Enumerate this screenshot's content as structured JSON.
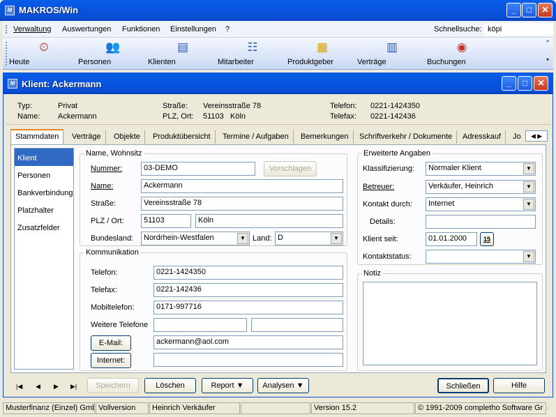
{
  "window": {
    "title": "MAKROS/Win",
    "icon": "app-icon",
    "icon_text": "M"
  },
  "menu": {
    "items": [
      "Verwaltung",
      "Auswertungen",
      "Funktionen",
      "Einstellungen",
      "?"
    ],
    "quicksearch_label": "Schnellsuche:",
    "quicksearch_value": "köpi"
  },
  "toolbar": {
    "items": [
      {
        "label": "Heute",
        "icon": "calendar-clock-icon"
      },
      {
        "label": "Personen",
        "icon": "people-icon"
      },
      {
        "label": "Klienten",
        "icon": "id-card-icon"
      },
      {
        "label": "Mitarbeiter",
        "icon": "org-chart-icon"
      },
      {
        "label": "Produktgeber",
        "icon": "products-icon"
      },
      {
        "label": "Verträge",
        "icon": "contract-chart-icon"
      },
      {
        "label": "Buchungen",
        "icon": "booking-icon"
      }
    ]
  },
  "child": {
    "title": "Klient: Ackermann",
    "info": {
      "typ_label": "Typ:",
      "typ_value": "Privat",
      "name_label": "Name:",
      "name_value": "Ackermann",
      "strasse_label": "Straße:",
      "strasse_value": "Vereinsstraße 78",
      "plz_label": "PLZ, Ort:",
      "plz_value": "51103   Köln",
      "telefon_label": "Telefon:",
      "telefon_value": "0221-1424350",
      "telefax_label": "Telefax:",
      "telefax_value": "0221-142436"
    },
    "tabs": [
      "Stammdaten",
      "Verträge",
      "Objekte",
      "Produktübersicht",
      "Termine / Aufgaben",
      "Bemerkungen",
      "Schriftverkehr / Dokumente",
      "Adresskauf",
      "Jo"
    ],
    "sidenav": [
      "Klient",
      "Personen",
      "Bankverbindung",
      "Platzhalter",
      "Zusatzfelder"
    ],
    "name_section": {
      "legend": "Name, Wohnsitz",
      "nummer_label": "Nummer:",
      "nummer_value": "03-DEMO",
      "vorschlagen": "Vorschlagen",
      "name_label": "Name:",
      "name_value": "Ackermann",
      "strasse_label": "Straße:",
      "strasse_value": "Vereinsstraße 78",
      "plz_label": "PLZ / Ort:",
      "plz_value": "51103",
      "ort_value": "Köln",
      "bundesland_label": "Bundesland:",
      "bundesland_value": "Nordrhein-Westfalen",
      "land_label": "Land:",
      "land_value": "D"
    },
    "comm_section": {
      "legend": "Kommunikation",
      "telefon_label": "Telefon:",
      "telefon_value": "0221-1424350",
      "telefax_label": "Telefax:",
      "telefax_value": "0221-142436",
      "mobil_label": "Mobiltelefon:",
      "mobil_value": "0171-997716",
      "weitere_label": "Weitere Telefone",
      "email_button": "E-Mail:",
      "email_value": "ackermann@aol.com",
      "internet_button": "Internet:",
      "internet_value": ""
    },
    "extended": {
      "legend": "Erweiterte Angaben",
      "klass_label": "Klassifizierung:",
      "klass_value": "Normaler Klient",
      "betreuer_label": "Betreuer:",
      "betreuer_value": "Verkäufer, Heinrich",
      "kontakt_label": "Kontakt durch:",
      "kontakt_value": "Internet",
      "details_label": "Details:",
      "details_value": "",
      "seit_label": "Klient seit:",
      "seit_value": "01.01.2000",
      "cal_text": "15",
      "status_label": "Kontaktstatus:",
      "status_value": ""
    },
    "notiz": {
      "legend": "Notiz",
      "value": ""
    },
    "footer": {
      "speichern": "Speichern",
      "loeschen": "Löschen",
      "report": "Report",
      "analysen": "Analysen",
      "schliessen": "Schließen",
      "hilfe": "Hilfe"
    }
  },
  "statusbar": [
    "Musterfinanz (Einzel) Gmb",
    "Vollversion",
    "Heinrich Verkäufer",
    "",
    "Version 15.2",
    "© 1991-2009 completho Software Gr"
  ]
}
